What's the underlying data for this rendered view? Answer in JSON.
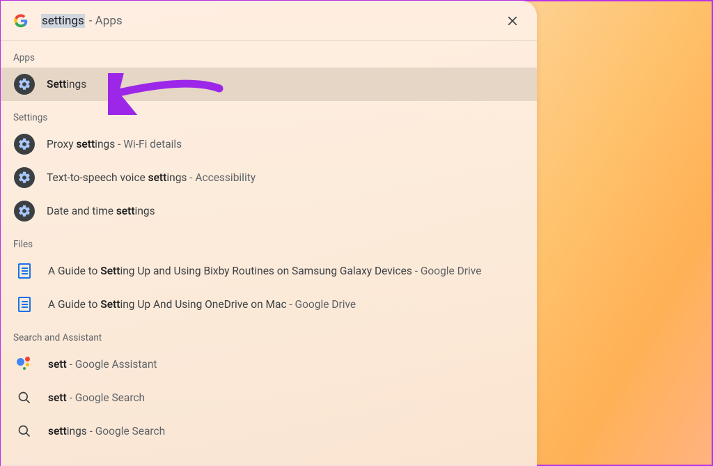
{
  "search": {
    "query": "settings",
    "context": "- Apps"
  },
  "sections": {
    "apps": {
      "label": "Apps",
      "items": [
        {
          "prefix": "Sett",
          "rest": "ings",
          "suffix": ""
        }
      ]
    },
    "settings": {
      "label": "Settings",
      "items": [
        {
          "prefix": "Proxy ",
          "bold": "sett",
          "rest": "ings",
          "suffix": " - Wi-Fi details"
        },
        {
          "prefix": "Text-to-speech voice ",
          "bold": "sett",
          "rest": "ings",
          "suffix": " - Accessibility"
        },
        {
          "prefix": "Date and time ",
          "bold": "sett",
          "rest": "ings",
          "suffix": ""
        }
      ]
    },
    "files": {
      "label": "Files",
      "items": [
        {
          "prefix": "A Guide to ",
          "bold": "Sett",
          "rest": "ing Up and Using Bixby Routines on Samsung Galaxy Devices",
          "suffix": " - Google Drive"
        },
        {
          "prefix": "A Guide to ",
          "bold": "Sett",
          "rest": "ing Up And Using OneDrive on Mac",
          "suffix": " - Google Drive"
        }
      ]
    },
    "sna": {
      "label": "Search and Assistant",
      "items": [
        {
          "bold": "sett",
          "rest": "",
          "suffix": " - Google Assistant",
          "icon": "assistant"
        },
        {
          "bold": "sett",
          "rest": "",
          "suffix": " - Google Search",
          "icon": "search"
        },
        {
          "bold": "sett",
          "rest": "ings",
          "suffix": " - Google Search",
          "icon": "search"
        }
      ]
    }
  },
  "annotation": {
    "color": "#9c27e8"
  }
}
